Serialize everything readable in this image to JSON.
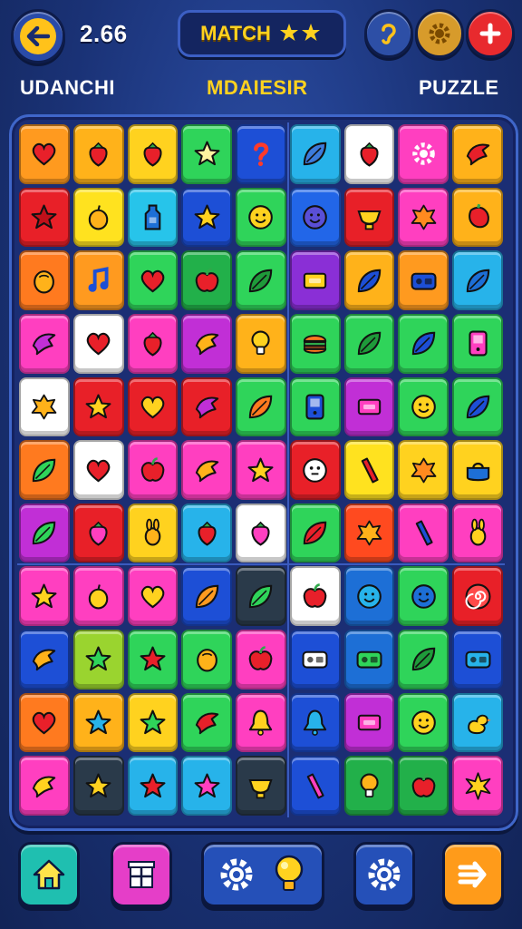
{
  "header": {
    "score": "2.66",
    "match_label": "MATCH",
    "icons": [
      "back-arrow-icon",
      "ear-icon",
      "gear-icon",
      "plus-icon"
    ]
  },
  "labels": {
    "left": "UDANCHI",
    "middle": "MDAIESIR",
    "right": "PUZZLE"
  },
  "board": {
    "rows": [
      [
        {
          "c": "#ff9a1f",
          "i": "heart",
          "f": "#e8202a"
        },
        {
          "c": "#ffb21a",
          "i": "strawberry",
          "f": "#e8202a"
        },
        {
          "c": "#ffd21f",
          "i": "strawberry",
          "f": "#e8202a"
        },
        {
          "c": "#2fd45a",
          "i": "star",
          "f": "#fff2a0"
        },
        {
          "c": "#1d4fd6",
          "i": "question",
          "f": "#ff3a2a"
        },
        {
          "c": "#27b3ea",
          "i": "leaf",
          "f": "#3c7bdc"
        },
        {
          "c": "#ffffff",
          "i": "strawberry",
          "f": "#e8202a"
        },
        {
          "c": "#ff3fc0",
          "i": "gear",
          "f": "#ffffff"
        },
        {
          "c": "#ffb21a",
          "i": "bird",
          "f": "#e8202a"
        }
      ],
      [
        {
          "c": "#e82028",
          "i": "star",
          "f": "#c0101a"
        },
        {
          "c": "#ffe21f",
          "i": "fruit",
          "f": "#ffb21a"
        },
        {
          "c": "#27c4ea",
          "i": "bottle",
          "f": "#1d6fd6"
        },
        {
          "c": "#1d4fd6",
          "i": "star",
          "f": "#ffd21f"
        },
        {
          "c": "#2fd45a",
          "i": "smile",
          "f": "#ffd21f"
        },
        {
          "c": "#2266e8",
          "i": "smile",
          "f": "#5a4fd6"
        },
        {
          "c": "#e82028",
          "i": "cup",
          "f": "#ffd21f"
        },
        {
          "c": "#ff3fc0",
          "i": "blob",
          "f": "#ff8a1f"
        },
        {
          "c": "#ffb21a",
          "i": "pepper",
          "f": "#e8202a"
        }
      ],
      [
        {
          "c": "#ff7a1f",
          "i": "nut",
          "f": "#ffb21a"
        },
        {
          "c": "#ff9a1f",
          "i": "note",
          "f": "#1d4fd6"
        },
        {
          "c": "#2fd45a",
          "i": "heart",
          "f": "#e8202a"
        },
        {
          "c": "#22b04a",
          "i": "apple",
          "f": "#e8202a"
        },
        {
          "c": "#2fd45a",
          "i": "leaf",
          "f": "#1f9a3a"
        },
        {
          "c": "#8a2fd6",
          "i": "box",
          "f": "#ffd21f"
        },
        {
          "c": "#ffb21a",
          "i": "leaf",
          "f": "#1d4fd6"
        },
        {
          "c": "#ff9a1f",
          "i": "radio",
          "f": "#1d4fd6"
        },
        {
          "c": "#27b3ea",
          "i": "leaf",
          "f": "#1d6fd6"
        }
      ],
      [
        {
          "c": "#ff3fc0",
          "i": "bird",
          "f": "#c12fd6"
        },
        {
          "c": "#ffffff",
          "i": "heart",
          "f": "#e8202a"
        },
        {
          "c": "#ff3fc0",
          "i": "strawberry",
          "f": "#e8202a"
        },
        {
          "c": "#c12fd6",
          "i": "bird",
          "f": "#ffb21a"
        },
        {
          "c": "#ffb21a",
          "i": "bulb",
          "f": "#ffd21f"
        },
        {
          "c": "#2fd45a",
          "i": "burger",
          "f": "#ff7a1f"
        },
        {
          "c": "#2fd45a",
          "i": "leaf",
          "f": "#1f9a3a"
        },
        {
          "c": "#2fd45a",
          "i": "leaf",
          "f": "#1d4fd6"
        },
        {
          "c": "#2fd45a",
          "i": "phone",
          "f": "#ff3fc0"
        }
      ],
      [
        {
          "c": "#ffffff",
          "i": "blob",
          "f": "#ffb21a"
        },
        {
          "c": "#e82028",
          "i": "star",
          "f": "#ffd21f"
        },
        {
          "c": "#e82028",
          "i": "heart",
          "f": "#ffd21f"
        },
        {
          "c": "#e82028",
          "i": "bird",
          "f": "#c12fd6"
        },
        {
          "c": "#2fd45a",
          "i": "leaf",
          "f": "#ff7a1f"
        },
        {
          "c": "#2fd45a",
          "i": "phone",
          "f": "#1d4fd6"
        },
        {
          "c": "#c12fd6",
          "i": "box",
          "f": "#ff3fc0"
        },
        {
          "c": "#2fd45a",
          "i": "smile",
          "f": "#ffd21f"
        },
        {
          "c": "#2fd45a",
          "i": "leaf",
          "f": "#1d4fd6"
        }
      ],
      [
        {
          "c": "#ff7a1f",
          "i": "leaf",
          "f": "#2fd45a"
        },
        {
          "c": "#ffffff",
          "i": "heart",
          "f": "#e8202a"
        },
        {
          "c": "#ff3fc0",
          "i": "apple",
          "f": "#e8202a"
        },
        {
          "c": "#ff3fc0",
          "i": "bird",
          "f": "#ffb21a"
        },
        {
          "c": "#ff3fc0",
          "i": "star",
          "f": "#ffd21f"
        },
        {
          "c": "#e82028",
          "i": "face",
          "f": "#ffffff"
        },
        {
          "c": "#ffe21f",
          "i": "stick",
          "f": "#e8202a"
        },
        {
          "c": "#ffd21f",
          "i": "blob",
          "f": "#ff8a1f"
        },
        {
          "c": "#ffd21f",
          "i": "pot",
          "f": "#1d6fd6"
        }
      ],
      [
        {
          "c": "#c12fd6",
          "i": "leaf",
          "f": "#2fd45a"
        },
        {
          "c": "#e82028",
          "i": "strawberry",
          "f": "#ff3fc0"
        },
        {
          "c": "#ffd21f",
          "i": "bunny",
          "f": "#ffb21a"
        },
        {
          "c": "#27b3ea",
          "i": "strawberry",
          "f": "#e8202a"
        },
        {
          "c": "#ffffff",
          "i": "strawberry",
          "f": "#ff3fc0"
        },
        {
          "c": "#2fd45a",
          "i": "leaf",
          "f": "#e8202a"
        },
        {
          "c": "#ff4a1f",
          "i": "blob",
          "f": "#ffb21a"
        },
        {
          "c": "#ff3fc0",
          "i": "stick",
          "f": "#1d4fd6"
        },
        {
          "c": "#ff3fc0",
          "i": "bunny",
          "f": "#ffd21f"
        }
      ],
      [
        {
          "c": "#ff3fc0",
          "i": "star",
          "f": "#ffd21f"
        },
        {
          "c": "#ff3fc0",
          "i": "fruit",
          "f": "#ffd21f"
        },
        {
          "c": "#ff3fc0",
          "i": "heart",
          "f": "#ffd21f"
        },
        {
          "c": "#1d4fd6",
          "i": "leaf",
          "f": "#ff9a1f"
        },
        {
          "c": "#2a3a4a",
          "i": "leaf",
          "f": "#2fd45a"
        },
        {
          "c": "#ffffff",
          "i": "apple",
          "f": "#e8202a"
        },
        {
          "c": "#1d6fd6",
          "i": "smile",
          "f": "#27b3ea"
        },
        {
          "c": "#2fd45a",
          "i": "smile",
          "f": "#1d6fd6"
        },
        {
          "c": "#e82028",
          "i": "spiral",
          "f": "#ff4a4a"
        }
      ],
      [
        {
          "c": "#1d4fd6",
          "i": "bird",
          "f": "#ffb21a"
        },
        {
          "c": "#9ad42f",
          "i": "star",
          "f": "#2fd45a"
        },
        {
          "c": "#2fd45a",
          "i": "star",
          "f": "#e8202a"
        },
        {
          "c": "#2fd45a",
          "i": "nut",
          "f": "#ffb21a"
        },
        {
          "c": "#ff3fc0",
          "i": "apple",
          "f": "#e8202a"
        },
        {
          "c": "#1d4fd6",
          "i": "radio",
          "f": "#ffffff"
        },
        {
          "c": "#1d6fd6",
          "i": "radio",
          "f": "#2fd45a"
        },
        {
          "c": "#2fd45a",
          "i": "leaf",
          "f": "#1f9a3a"
        },
        {
          "c": "#1d4fd6",
          "i": "radio",
          "f": "#27b3ea"
        }
      ],
      [
        {
          "c": "#ff7a1f",
          "i": "heart",
          "f": "#e8202a"
        },
        {
          "c": "#ffb21a",
          "i": "star",
          "f": "#27b3ea"
        },
        {
          "c": "#ffd21f",
          "i": "star",
          "f": "#2fd45a"
        },
        {
          "c": "#2fd45a",
          "i": "bird",
          "f": "#e8202a"
        },
        {
          "c": "#ff3fc0",
          "i": "bell",
          "f": "#ffd21f"
        },
        {
          "c": "#1d4fd6",
          "i": "bell",
          "f": "#27b3ea"
        },
        {
          "c": "#c12fd6",
          "i": "box",
          "f": "#ff3fc0"
        },
        {
          "c": "#2fd45a",
          "i": "smile",
          "f": "#ffd21f"
        },
        {
          "c": "#27b3ea",
          "i": "duck",
          "f": "#ffd21f"
        }
      ],
      [
        {
          "c": "#ff3fc0",
          "i": "bird",
          "f": "#ffd21f"
        },
        {
          "c": "#2a3a4a",
          "i": "star",
          "f": "#ffd21f"
        },
        {
          "c": "#27b3ea",
          "i": "star",
          "f": "#e8202a"
        },
        {
          "c": "#27b3ea",
          "i": "star",
          "f": "#ff3fc0"
        },
        {
          "c": "#2a3a4a",
          "i": "cup",
          "f": "#ffd21f"
        },
        {
          "c": "#1d4fd6",
          "i": "stick",
          "f": "#ff3fc0"
        },
        {
          "c": "#22b04a",
          "i": "bulb",
          "f": "#ffb21a"
        },
        {
          "c": "#22b04a",
          "i": "apple",
          "f": "#e8202a"
        },
        {
          "c": "#ff3fc0",
          "i": "burst",
          "f": "#ffd21f"
        }
      ]
    ]
  },
  "footer": {
    "icons": [
      "home-icon",
      "shop-icon",
      "gear-icon",
      "hint-bulb-icon",
      "gear-icon",
      "next-arrow-icon"
    ]
  }
}
